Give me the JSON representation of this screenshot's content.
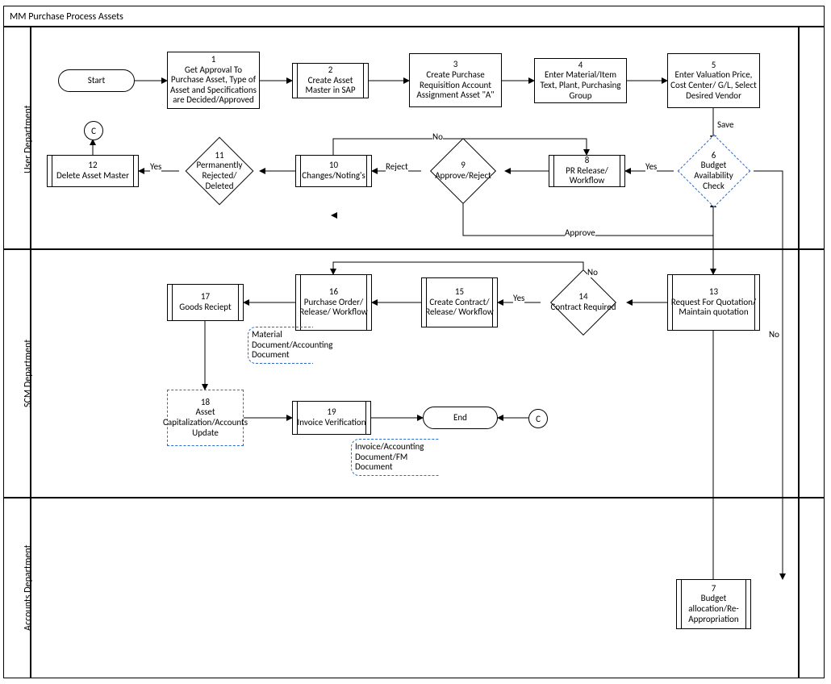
{
  "diagram": {
    "title": "MM Purchase Process Assets",
    "lanes": {
      "user": "User Department",
      "scm": "SCM Department",
      "accounts": "Accounts Department"
    },
    "nodes": {
      "start": "Start",
      "end": "End",
      "c1": "C",
      "c2": "C",
      "n1": "1\nGet Approval To Purchase Asset, Type of Asset and Specifications are Decided/Approved",
      "n2": "2\nCreate Asset Master in SAP",
      "n3": "3\nCreate Purchase Requisition Account Assignment Asset \"A\"",
      "n4": "4\nEnter Material/Item Text, Plant, Purchasing Group",
      "n5": "5\nEnter Valuation Price, Cost Center/ G/L, Select Desired Vendor",
      "n6": "6\nBudget Availability Check",
      "n7": "7\nBudget allocation/Re-Appropriation",
      "n8": "8\nPR Release/ Workflow",
      "n9": "9\nApprove/Reject",
      "n10": "10\nChanges/Noting's",
      "n11": "11\nPermanently Rejected/ Deleted",
      "n12": "12\nDelete Asset Master",
      "n13": "13\nRequest For Quotation/ Maintain quotation",
      "n14": "14\nContract Required",
      "n15": "15\nCreate Contract/ Release/ Workflow",
      "n16": "16\nPurchase Order/ Release/ Workflow",
      "n17": "17\nGoods Reciept",
      "n18": "18\nAsset Capitalization/Accounts Update",
      "n19": "19\nInvoice Verification"
    },
    "annotations": {
      "a17": "Material Document/Accounting Document",
      "a19": "Invoice/Accounting Document/FM Document"
    },
    "edgeLabels": {
      "save": "Save",
      "yes6": "Yes",
      "no6": "No",
      "reject9": "Reject",
      "approve9": "Approve",
      "no10": "No",
      "yes11": "Yes",
      "yes14": "Yes",
      "no14": "No"
    }
  }
}
